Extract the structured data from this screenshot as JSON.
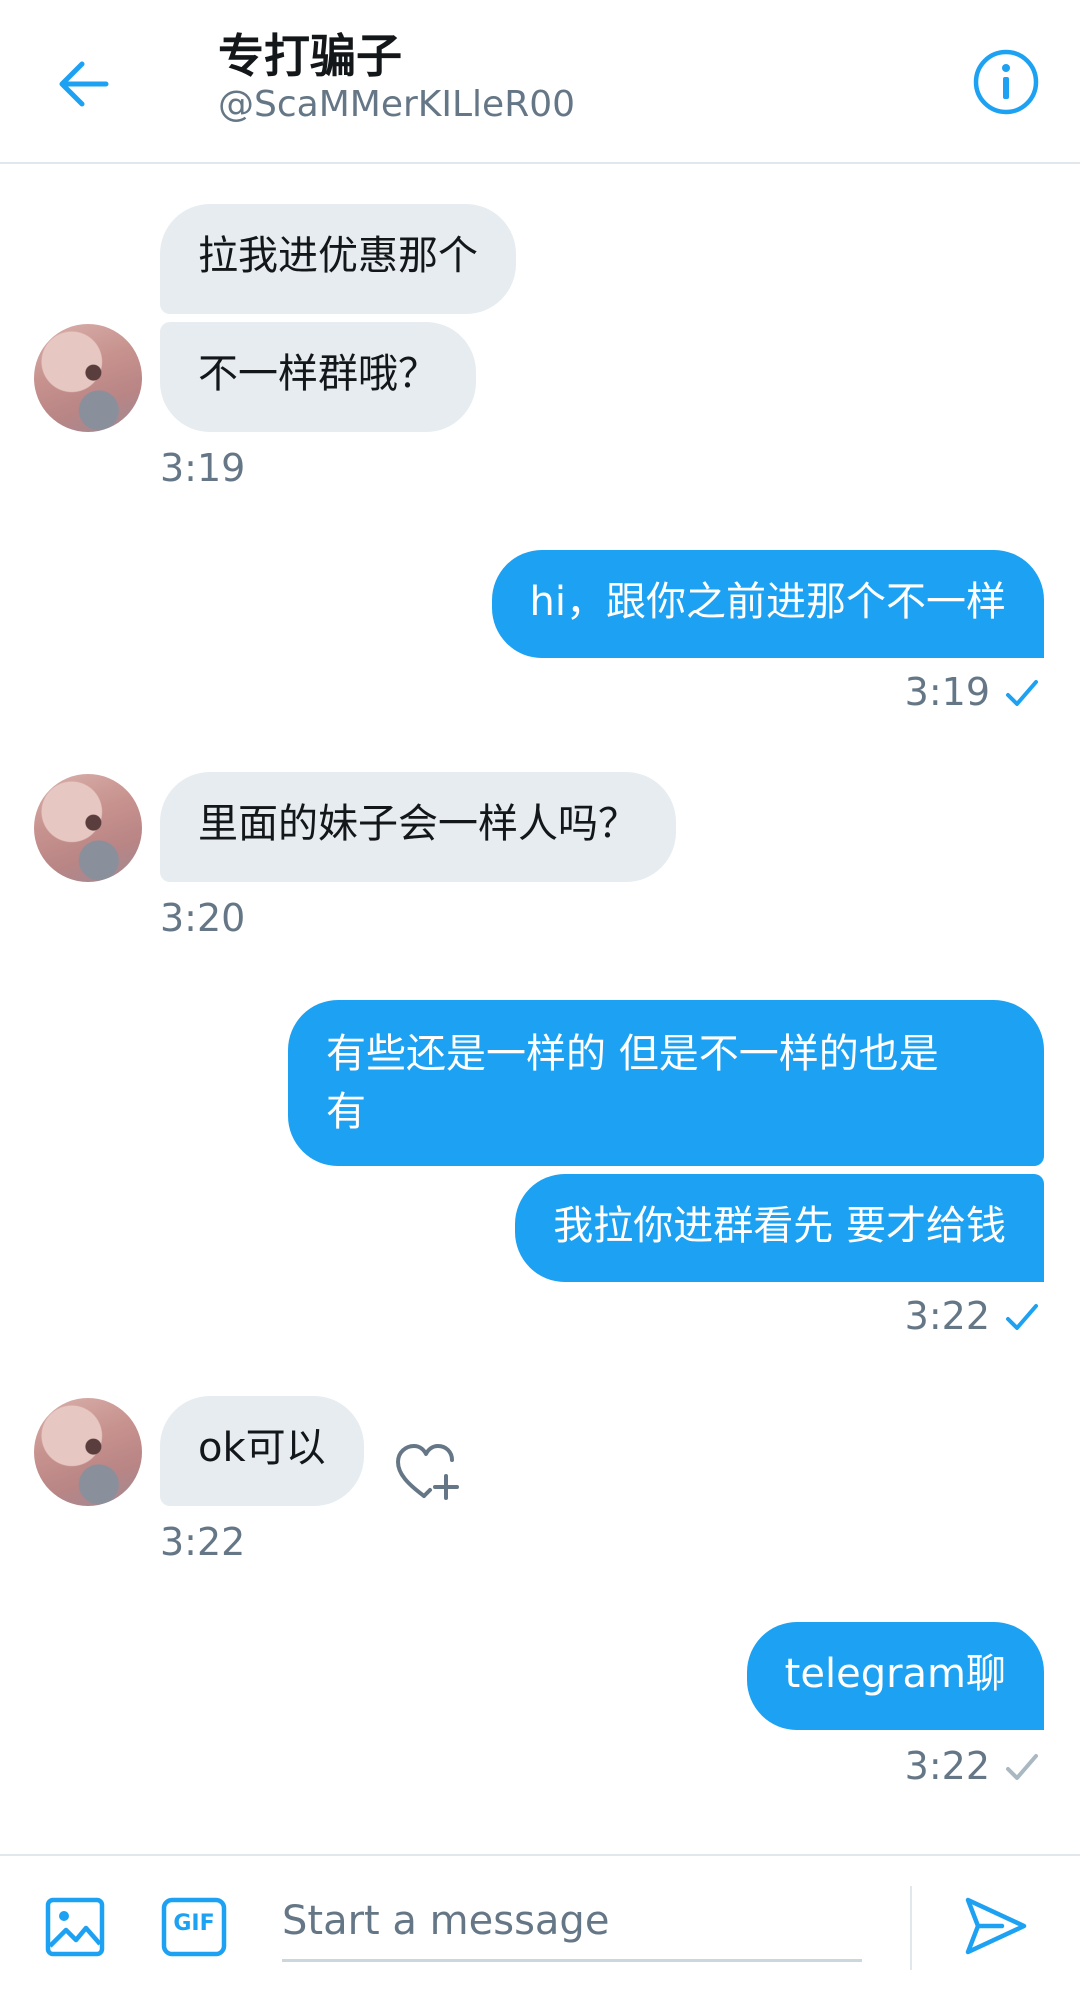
{
  "header": {
    "title": "专打骗子",
    "handle": "@ScaMMerKILleR00"
  },
  "messages": [
    {
      "text": "拉我进优惠那个"
    },
    {
      "text": "不一样群哦？"
    },
    {
      "text": "hi，跟你之前进那个不一样"
    },
    {
      "text": "里面的妹子会一样人吗？"
    },
    {
      "text_line1": "有些还是一样的 但是不一样的也是",
      "text_line2": "有"
    },
    {
      "text": "我拉你进群看先 要才给钱"
    },
    {
      "text": "ok可以"
    },
    {
      "text": "telegram聊"
    }
  ],
  "times": {
    "t1": "3:19",
    "t2": "3:19",
    "t3": "3:20",
    "t4": "3:22",
    "t5": "3:22",
    "t6": "3:22"
  },
  "composer": {
    "placeholder": "Start a message",
    "gif_label": "GIF"
  },
  "colors": {
    "accent": "#1da1f2",
    "incoming_bubble": "#e6ecf0",
    "meta_text": "#657786"
  }
}
